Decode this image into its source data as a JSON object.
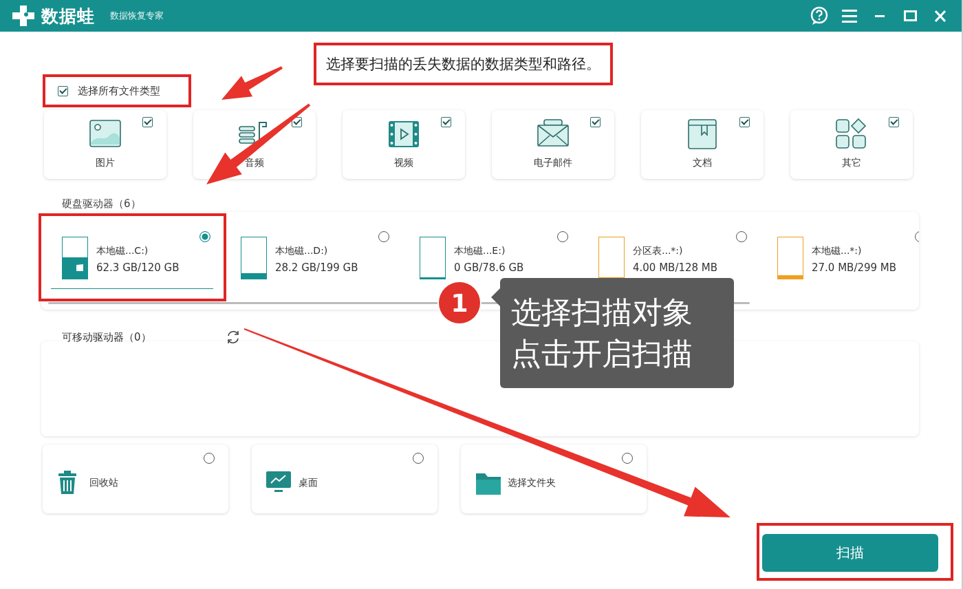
{
  "window": {
    "title": "数据蛙",
    "subtitle": "数据恢复专家"
  },
  "instruction": "选择要扫描的丢失数据的数据类型和路径。",
  "select_all": {
    "label": "选择所有文件类型",
    "checked": true
  },
  "file_types": [
    {
      "label": "图片",
      "kind": "image",
      "checked": true
    },
    {
      "label": "音频",
      "kind": "audio",
      "checked": true
    },
    {
      "label": "视频",
      "kind": "video",
      "checked": true
    },
    {
      "label": "电子邮件",
      "kind": "mail",
      "checked": true
    },
    {
      "label": "文档",
      "kind": "document",
      "checked": true
    },
    {
      "label": "其它",
      "kind": "other",
      "checked": true
    }
  ],
  "hard_drives": {
    "title": "硬盘驱动器（6）",
    "drives": [
      {
        "name": "本地磁...C:)",
        "size": "62.3 GB/120 GB",
        "level": 0.52,
        "color": "#16908e",
        "system": true,
        "selected": true
      },
      {
        "name": "本地磁...D:)",
        "size": "28.2 GB/199 GB",
        "level": 0.14,
        "color": "#16908e",
        "system": false,
        "selected": false
      },
      {
        "name": "本地磁...E:)",
        "size": "0 GB/78.6 GB",
        "level": 0.03,
        "color": "#16908e",
        "system": false,
        "selected": false
      },
      {
        "name": "分区表...*:)",
        "size": "4.00 MB/128 MB",
        "level": 0.03,
        "color": "#f0a020",
        "system": false,
        "selected": false
      },
      {
        "name": "本地磁...*:)",
        "size": "27.0 MB/299 MB",
        "level": 0.09,
        "color": "#f0a020",
        "system": false,
        "selected": false
      }
    ]
  },
  "removable": {
    "title": "可移动驱动器（0）"
  },
  "locations": [
    {
      "label": "回收站",
      "kind": "trash",
      "selected": false
    },
    {
      "label": "桌面",
      "kind": "desktop",
      "selected": false
    },
    {
      "label": "选择文件夹",
      "kind": "folder",
      "selected": false
    }
  ],
  "scan_button": "扫描",
  "callout": {
    "badge": "1",
    "lines": [
      "选择扫描对象",
      "点击开启扫描"
    ]
  }
}
